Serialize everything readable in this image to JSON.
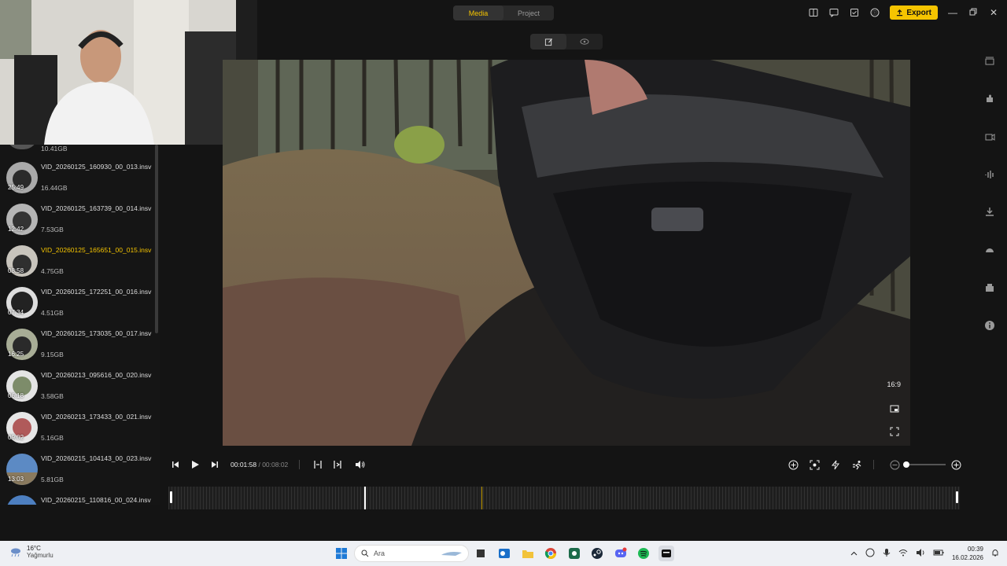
{
  "topbar": {
    "tabs": [
      "Media",
      "Project"
    ],
    "active_tab": "Media",
    "export_label": "Export",
    "accent": "#f5c400"
  },
  "media": {
    "partial_top_size": "10.41GB",
    "items": [
      {
        "name": "VID_20260125_160930_00_013.insv",
        "size": "16.44GB",
        "time": "25:49"
      },
      {
        "name": "VID_20260125_163739_00_014.insv",
        "size": "7.53GB",
        "time": "12:42"
      },
      {
        "name": "VID_20260125_165651_00_015.insv",
        "size": "4.75GB",
        "time": "08:58",
        "selected": true
      },
      {
        "name": "VID_20260125_172251_00_016.insv",
        "size": "4.51GB",
        "time": "07:34"
      },
      {
        "name": "VID_20260125_173035_00_017.insv",
        "size": "9.15GB",
        "time": "16:25"
      },
      {
        "name": "VID_20260213_095616_00_020.insv",
        "size": "3.58GB",
        "time": "06:18"
      },
      {
        "name": "VID_20260213_173433_00_021.insv",
        "size": "5.16GB",
        "time": "09:02"
      },
      {
        "name": "VID_20260215_104143_00_023.insv",
        "size": "5.81GB",
        "time": "13:03"
      },
      {
        "name": "VID_20260215_110816_00_024.insv",
        "size": "",
        "time": ""
      }
    ]
  },
  "preview": {
    "aspect_label": "16:9"
  },
  "playback": {
    "current_time": "00:01:58",
    "total_time": "/ 00:08:02",
    "zoom_level": 0.0,
    "playhead_fraction": 0.248
  },
  "taskbar": {
    "temperature": "16°C",
    "weather": "Yağmurlu",
    "search_placeholder": "Ara",
    "time": "00:39",
    "date": "16.02.2026"
  }
}
